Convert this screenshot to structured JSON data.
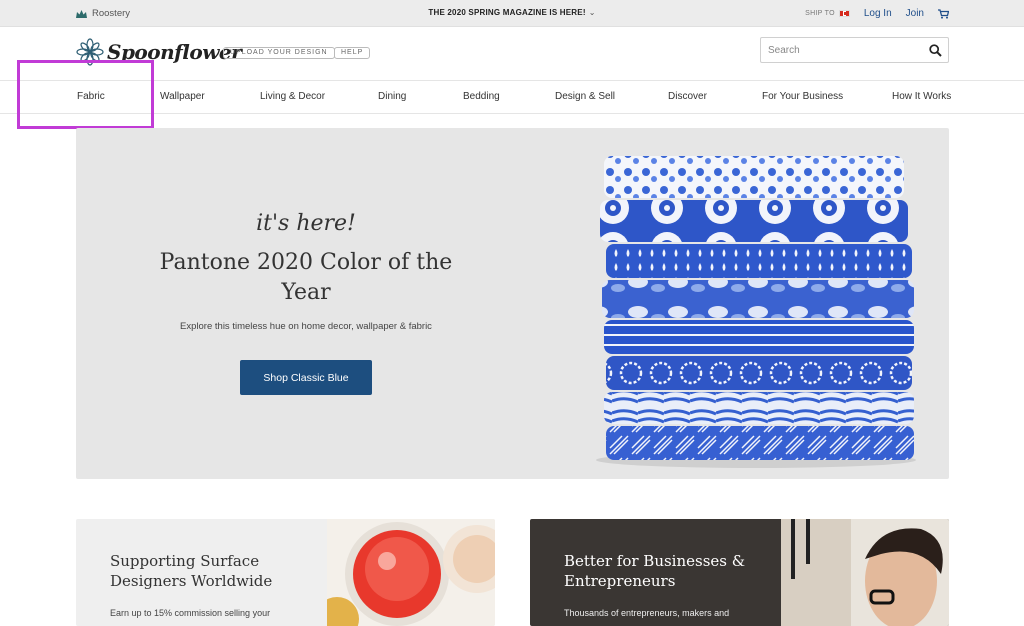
{
  "topbar": {
    "roostery_label": "Roostery",
    "promo_text": "THE 2020 SPRING MAGAZINE IS HERE!",
    "ship_to_label": "SHIP TO",
    "login_label": "Log In",
    "join_label": "Join"
  },
  "header": {
    "logo_text": "Spoonflower",
    "upload_label": "UPLOAD YOUR DESIGN",
    "help_label": "HELP",
    "search_placeholder": "Search"
  },
  "nav": {
    "items": [
      {
        "label": "Fabric"
      },
      {
        "label": "Wallpaper"
      },
      {
        "label": "Living & Decor"
      },
      {
        "label": "Dining"
      },
      {
        "label": "Bedding"
      },
      {
        "label": "Design & Sell"
      },
      {
        "label": "Discover"
      },
      {
        "label": "For Your Business"
      },
      {
        "label": "How It Works"
      }
    ]
  },
  "hero": {
    "script": "it's here!",
    "title": "Pantone 2020 Color of the Year",
    "subtitle": "Explore this timeless hue on home decor, wallpaper & fabric",
    "button_label": "Shop Classic Blue"
  },
  "cards": [
    {
      "title": "Supporting Surface Designers Worldwide",
      "text": "Earn up to 15% commission selling your"
    },
    {
      "title": "Better for Businesses & Entrepreneurs",
      "text": "Thousands of entrepreneurs, makers and"
    }
  ],
  "colors": {
    "accent_blue": "#1d4e7f",
    "highlight": "#c13bd6",
    "link_blue": "#1f4e8a"
  }
}
